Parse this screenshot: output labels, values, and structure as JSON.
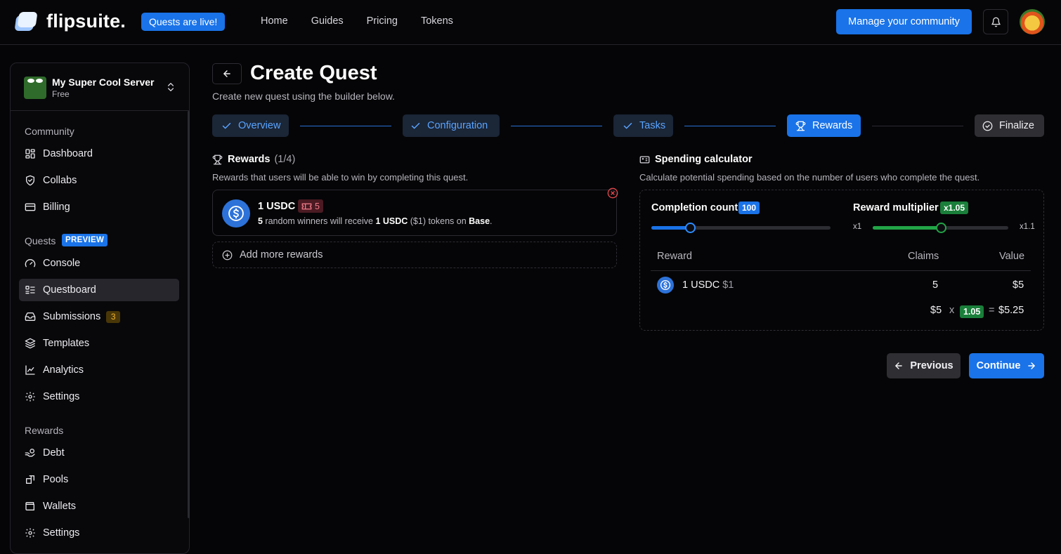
{
  "brand": {
    "name": "flipsuite.",
    "badge": "Quests are live!"
  },
  "nav": [
    "Home",
    "Guides",
    "Pricing",
    "Tokens"
  ],
  "header": {
    "manage_label": "Manage your community"
  },
  "server": {
    "name": "My Super Cool Server",
    "plan": "Free"
  },
  "sidebar": {
    "community_label": "Community",
    "community_items": [
      "Dashboard",
      "Collabs",
      "Billing"
    ],
    "quests_label": "Quests",
    "quests_badge": "PREVIEW",
    "quests_items": [
      "Console",
      "Questboard",
      "Submissions",
      "Templates",
      "Analytics",
      "Settings"
    ],
    "submissions_count": "3",
    "active_item": "Questboard",
    "rewards_label": "Rewards",
    "rewards_items": [
      "Debt",
      "Pools",
      "Wallets",
      "Settings"
    ]
  },
  "page": {
    "title": "Create Quest",
    "subtitle": "Create new quest using the builder below."
  },
  "steps": [
    {
      "label": "Overview",
      "state": "done"
    },
    {
      "label": "Configuration",
      "state": "done"
    },
    {
      "label": "Tasks",
      "state": "done"
    },
    {
      "label": "Rewards",
      "state": "current"
    },
    {
      "label": "Finalize",
      "state": "todo"
    }
  ],
  "rewards": {
    "title": "Rewards",
    "count": "(1/4)",
    "description": "Rewards that users will be able to win by completing this quest.",
    "items": [
      {
        "name": "1 USDC",
        "winners": "5",
        "desc_mid": " random winners will receive ",
        "amount": "1 USDC",
        "usd": " ($1) tokens on ",
        "chain": "Base",
        "end": "."
      }
    ],
    "add_more_label": "Add more rewards"
  },
  "calculator": {
    "title": "Spending calculator",
    "description": "Calculate potential spending based on the number of users who complete the quest.",
    "completion_label": "Completion count",
    "completion_value": "100",
    "completion_fraction": 0.215,
    "multiplier_label": "Reward multiplier",
    "multiplier_value": "x1.05",
    "multiplier_min": "x1",
    "multiplier_max": "x1.1",
    "multiplier_fraction": 0.5,
    "columns": [
      "Reward",
      "Claims",
      "Value"
    ],
    "row": {
      "reward": "1 USDC",
      "price": "$1",
      "claims": "5",
      "value": "$5"
    },
    "formula": {
      "base": "$5",
      "times": "x",
      "multiplier": "1.05",
      "equals": "=",
      "total": "$5.25"
    }
  },
  "buttons": {
    "previous": "Previous",
    "continue": "Continue"
  },
  "colors": {
    "accent": "#1a73e8",
    "done_text": "#5aa4ff",
    "green": "#22a447",
    "background": "#050507"
  }
}
